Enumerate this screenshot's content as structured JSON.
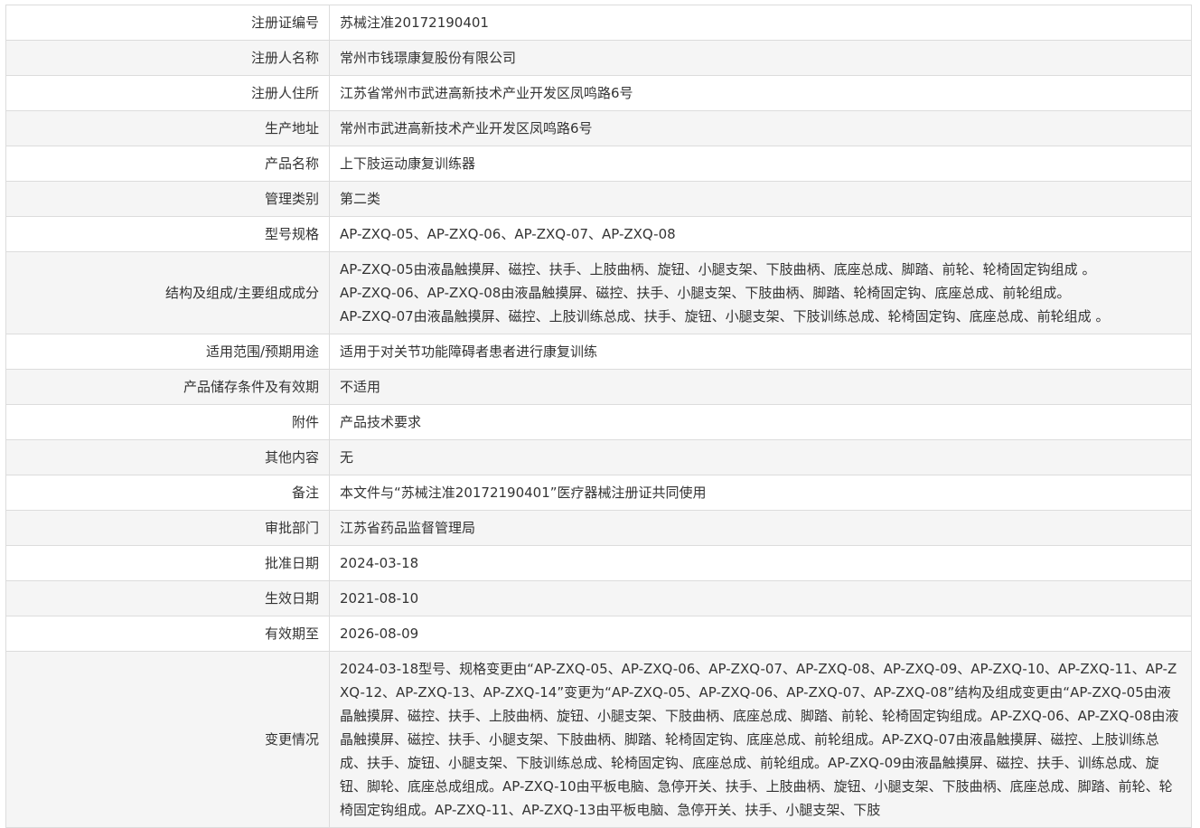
{
  "rows": [
    {
      "label": "注册证编号",
      "value": "苏械注准20172190401"
    },
    {
      "label": "注册人名称",
      "value": "常州市钱璟康复股份有限公司"
    },
    {
      "label": "注册人住所",
      "value": "江苏省常州市武进高新技术产业开发区凤鸣路6号"
    },
    {
      "label": "生产地址",
      "value": "常州市武进高新技术产业开发区凤鸣路6号"
    },
    {
      "label": "产品名称",
      "value": "上下肢运动康复训练器"
    },
    {
      "label": "管理类别",
      "value": "第二类"
    },
    {
      "label": "型号规格",
      "value": "AP-ZXQ-05、AP-ZXQ-06、AP-ZXQ-07、AP-ZXQ-08"
    },
    {
      "label": "结构及组成/主要组成成分",
      "lines": [
        "AP-ZXQ-05由液晶触摸屏、磁控、扶手、上肢曲柄、旋钮、小腿支架、下肢曲柄、底座总成、脚踏、前轮、轮椅固定钩组成 。",
        "AP-ZXQ-06、AP-ZXQ-08由液晶触摸屏、磁控、扶手、小腿支架、下肢曲柄、脚踏、轮椅固定钩、底座总成、前轮组成。",
        "AP-ZXQ-07由液晶触摸屏、磁控、上肢训练总成、扶手、旋钮、小腿支架、下肢训练总成、轮椅固定钩、底座总成、前轮组成 。"
      ]
    },
    {
      "label": "适用范围/预期用途",
      "value": "适用于对关节功能障碍者患者进行康复训练"
    },
    {
      "label": "产品储存条件及有效期",
      "value": "不适用"
    },
    {
      "label": "附件",
      "value": "产品技术要求"
    },
    {
      "label": "其他内容",
      "value": "无"
    },
    {
      "label": "备注",
      "value": "本文件与“苏械注准20172190401”医疗器械注册证共同使用"
    },
    {
      "label": "审批部门",
      "value": "江苏省药品监督管理局"
    },
    {
      "label": "批准日期",
      "value": "2024-03-18"
    },
    {
      "label": "生效日期",
      "value": "2021-08-10"
    },
    {
      "label": "有效期至",
      "value": "2026-08-09"
    },
    {
      "label": "变更情况",
      "value": "2024-03-18型号、规格变更由“AP-ZXQ-05、AP-ZXQ-06、AP-ZXQ-07、AP-ZXQ-08、AP-ZXQ-09、AP-ZXQ-10、AP-ZXQ-11、AP-ZXQ-12、AP-ZXQ-13、AP-ZXQ-14”变更为“AP-ZXQ-05、AP-ZXQ-06、AP-ZXQ-07、AP-ZXQ-08”结构及组成变更由“AP-ZXQ-05由液晶触摸屏、磁控、扶手、上肢曲柄、旋钮、小腿支架、下肢曲柄、底座总成、脚踏、前轮、轮椅固定钩组成。AP-ZXQ-06、AP-ZXQ-08由液晶触摸屏、磁控、扶手、小腿支架、下肢曲柄、脚踏、轮椅固定钩、底座总成、前轮组成。AP-ZXQ-07由液晶触摸屏、磁控、上肢训练总成、扶手、旋钮、小腿支架、下肢训练总成、轮椅固定钩、底座总成、前轮组成。AP-ZXQ-09由液晶触摸屏、磁控、扶手、训练总成、旋钮、脚轮、底座总成组成。AP-ZXQ-10由平板电脑、急停开关、扶手、上肢曲柄、旋钮、小腿支架、下肢曲柄、底座总成、脚踏、前轮、轮椅固定钩组成。AP-ZXQ-11、AP-ZXQ-13由平板电脑、急停开关、扶手、小腿支架、下肢"
    }
  ]
}
